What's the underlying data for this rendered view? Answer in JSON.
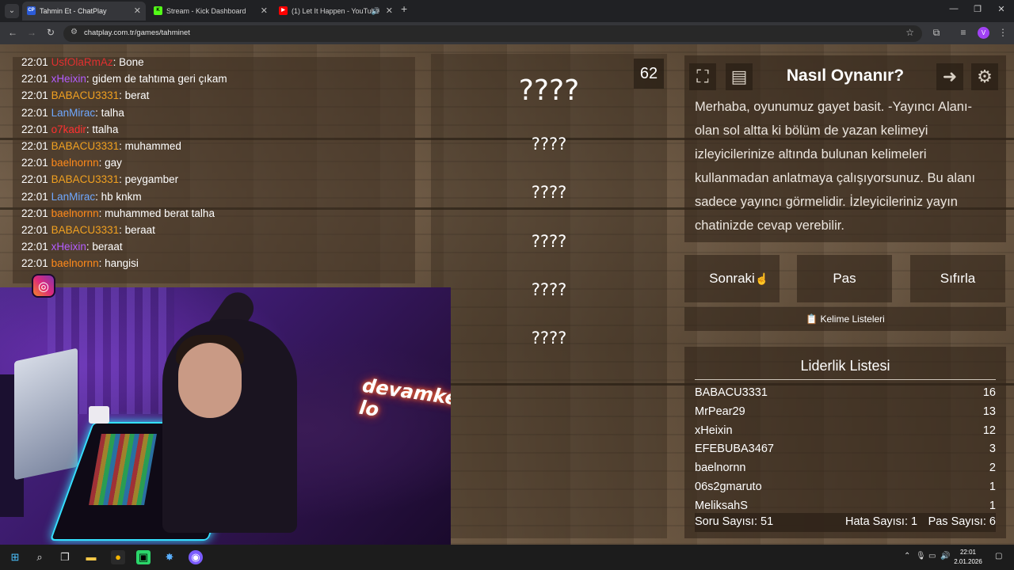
{
  "browser": {
    "tabs": [
      {
        "title": "Tahmin Et - ChatPlay",
        "favicon": "CP",
        "active": true
      },
      {
        "title": "Stream - Kick Dashboard",
        "favicon": "K",
        "active": false
      },
      {
        "title": "(1) Let It Happen - YouTube",
        "favicon": "▶",
        "active": false
      }
    ],
    "url": "chatplay.com.tr/games/tahminet",
    "profile_initial": "V"
  },
  "chat": {
    "messages": [
      {
        "time": "22:01",
        "user": "UsfOlaRmAz",
        "user_color": "#e03030",
        "text": ": Bone"
      },
      {
        "time": "22:01",
        "user": "xHeixin",
        "user_color": "#b45cff",
        "text": ": gidem de tahtıma geri çıkam"
      },
      {
        "time": "22:01",
        "user": "BABACU3331",
        "user_color": "#f0a020",
        "text": ": berat"
      },
      {
        "time": "22:01",
        "user": "LanMirac",
        "user_color": "#6fa8ff",
        "text": ": talha"
      },
      {
        "time": "22:01",
        "user": "o7kadir",
        "user_color": "#ff3030",
        "text": ": ttalha"
      },
      {
        "time": "22:01",
        "user": "BABACU3331",
        "user_color": "#f0a020",
        "text": ": muhammed"
      },
      {
        "time": "22:01",
        "user": "baelnornn",
        "user_color": "#ff8a1a",
        "text": ": gay"
      },
      {
        "time": "22:01",
        "user": "BABACU3331",
        "user_color": "#f0a020",
        "text": ": peygamber"
      },
      {
        "time": "22:01",
        "user": "LanMirac",
        "user_color": "#6fa8ff",
        "text": ": hb knkm"
      },
      {
        "time": "22:01",
        "user": "baelnornn",
        "user_color": "#ff8a1a",
        "text": ": muhammed berat talha"
      },
      {
        "time": "22:01",
        "user": "BABACU3331",
        "user_color": "#f0a020",
        "text": ": beraat"
      },
      {
        "time": "22:01",
        "user": "xHeixin",
        "user_color": "#b45cff",
        "text": ": beraat"
      },
      {
        "time": "22:01",
        "user": "baelnornn",
        "user_color": "#ff8a1a",
        "text": ": hangisi"
      }
    ]
  },
  "game": {
    "timer": "62",
    "main_word": "????",
    "hidden_words": [
      "????",
      "????",
      "????",
      "????",
      "????"
    ]
  },
  "howto": {
    "title": "Nasıl Oynanır?",
    "text": "Merhaba, oyunumuz gayet basit. -Yayıncı Alanı- olan sol altta ki bölüm de yazan kelimeyi izleyicilerinize altında bulunan kelimeleri kullanmadan anlatmaya çalışıyorsunuz. Bu alanı sadece yayıncı görmelidir. İzleyicileriniz yayın chatinizde cevap verebilir."
  },
  "actions": {
    "next": "Sonraki",
    "pass": "Pas",
    "reset": "Sıfırla",
    "word_lists": "Kelime Listeleri"
  },
  "leaderboard": {
    "title": "Liderlik Listesi",
    "rows": [
      {
        "name": "BABACU3331",
        "score": "16"
      },
      {
        "name": "MrPear29",
        "score": "13"
      },
      {
        "name": "xHeixin",
        "score": "12"
      },
      {
        "name": "EFEBUBA3467",
        "score": "3"
      },
      {
        "name": "baelnornn",
        "score": "2"
      },
      {
        "name": "06s2gmaruto",
        "score": "1"
      },
      {
        "name": "MeliksahS",
        "score": "1"
      }
    ],
    "question_count": "Soru Sayısı: 51",
    "error_count": "Hata Sayısı: 1",
    "pass_count": "Pas Sayısı: 6"
  },
  "webcam": {
    "sign_text": "devamke lo"
  },
  "taskbar": {
    "time": "22:01",
    "date": "2.01.2026"
  }
}
